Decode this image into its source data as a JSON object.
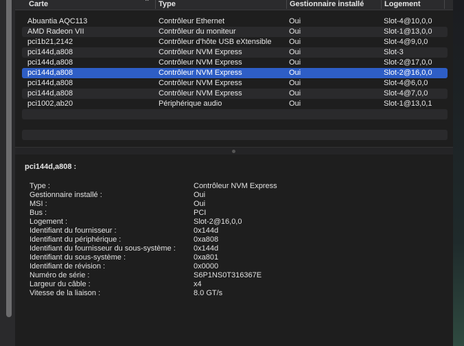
{
  "table": {
    "columns": [
      "Carte",
      "Type",
      "Gestionnaire installé",
      "Logement"
    ],
    "rows": [
      {
        "carte": "Abuantia AQC113",
        "type": "Contrôleur Ethernet",
        "gest": "Oui",
        "logement": "Slot-4@10,0,0"
      },
      {
        "carte": "AMD Radeon VII",
        "type": "Contrôleur du moniteur",
        "gest": "Oui",
        "logement": "Slot-1@13,0,0"
      },
      {
        "carte": "pci1b21,2142",
        "type": "Contrôleur d’hôte USB eXtensible",
        "gest": "Oui",
        "logement": "Slot-4@9,0,0"
      },
      {
        "carte": "pci144d,a808",
        "type": "Contrôleur NVM Express",
        "gest": "Oui",
        "logement": "Slot-3"
      },
      {
        "carte": "pci144d,a808",
        "type": "Contrôleur NVM Express",
        "gest": "Oui",
        "logement": "Slot-2@17,0,0"
      },
      {
        "carte": "pci144d,a808",
        "type": "Contrôleur NVM Express",
        "gest": "Oui",
        "logement": "Slot-2@16,0,0"
      },
      {
        "carte": "pci144d,a808",
        "type": "Contrôleur NVM Express",
        "gest": "Oui",
        "logement": "Slot-4@6,0,0"
      },
      {
        "carte": "pci144d,a808",
        "type": "Contrôleur NVM Express",
        "gest": "Oui",
        "logement": "Slot-4@7,0,0"
      },
      {
        "carte": "pci1002,ab20",
        "type": "Périphérique audio",
        "gest": "Oui",
        "logement": "Slot-1@13,0,1"
      }
    ],
    "selected_index": 5
  },
  "details": {
    "title": "pci144d,a808 :",
    "fields": [
      {
        "k": "Type :",
        "v": "Contrôleur NVM Express"
      },
      {
        "k": "Gestionnaire installé :",
        "v": "Oui"
      },
      {
        "k": "MSI :",
        "v": "Oui"
      },
      {
        "k": "Bus :",
        "v": "PCI"
      },
      {
        "k": "Logement :",
        "v": "Slot-2@16,0,0"
      },
      {
        "k": "Identifiant du fournisseur :",
        "v": "0x144d"
      },
      {
        "k": "Identifiant du périphérique :",
        "v": "0xa808"
      },
      {
        "k": "Identifiant du fournisseur du sous-système :",
        "v": "0x144d"
      },
      {
        "k": "Identifiant du sous-système :",
        "v": "0xa801"
      },
      {
        "k": "Identifiant de révision :",
        "v": "0x0000"
      },
      {
        "k": "Numéro de série :",
        "v": "S6P1NS0T316367E"
      },
      {
        "k": "Largeur du câble :",
        "v": "x4"
      },
      {
        "k": "Vitesse de la liaison :",
        "v": "8.0 GT/s"
      }
    ]
  },
  "colors": {
    "selection": "#2e5ec6",
    "background": "#1e1e1e"
  },
  "icons": {
    "sort": "chevron-up-icon"
  }
}
